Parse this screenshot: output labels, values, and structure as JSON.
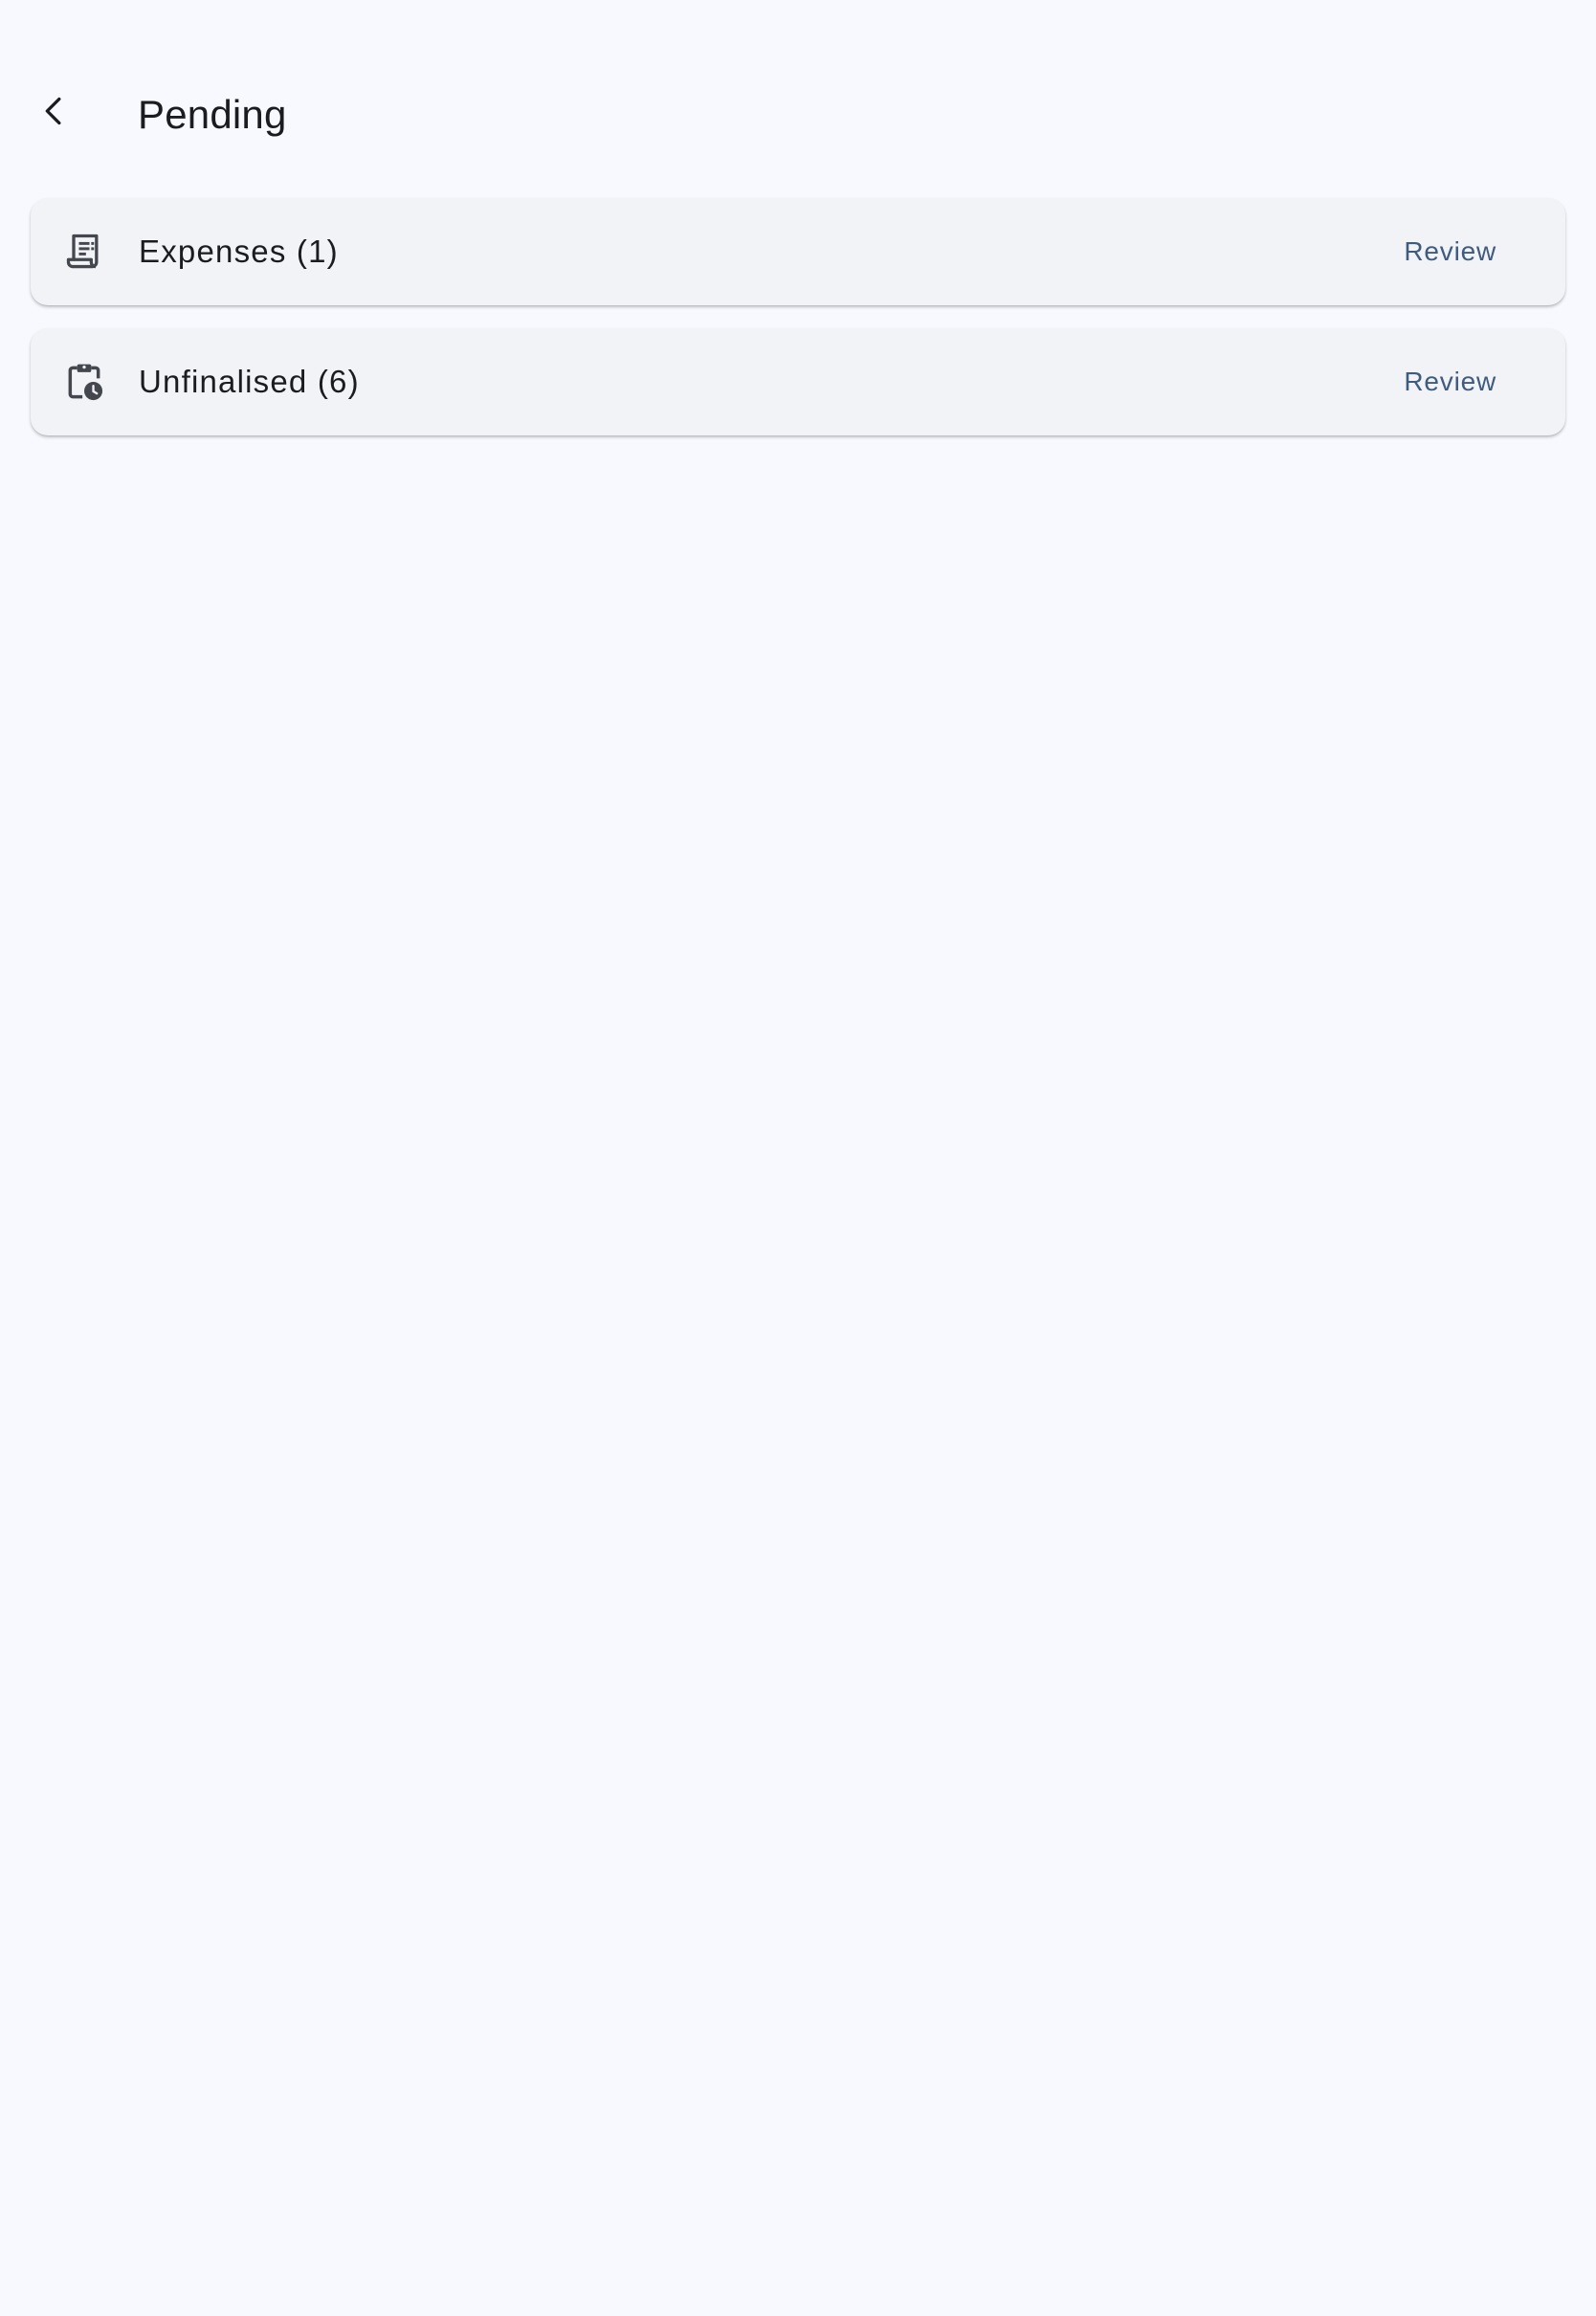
{
  "header": {
    "back_icon": "chevron-left-icon",
    "title": "Pending"
  },
  "items": [
    {
      "icon": "receipt-icon",
      "label": "Expenses (1)",
      "action_label": "Review"
    },
    {
      "icon": "clipboard-clock-icon",
      "label": "Unfinalised (6)",
      "action_label": "Review"
    }
  ],
  "colors": {
    "background": "#f8f9fe",
    "card": "#f2f3f7",
    "accent": "#3f5b7e",
    "text": "#1b1c20"
  }
}
